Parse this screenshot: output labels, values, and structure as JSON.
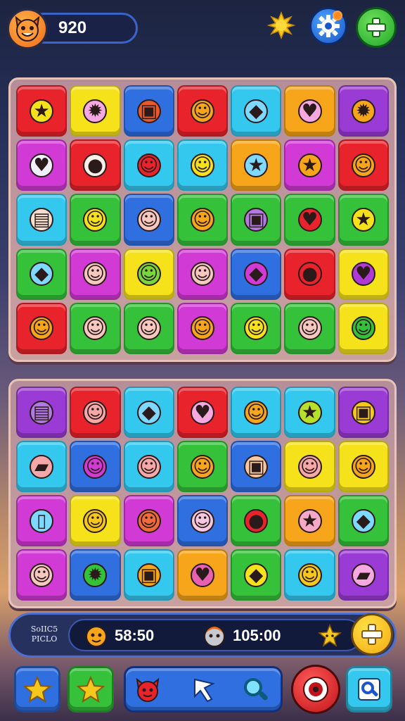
{
  "header": {
    "score": "920",
    "avatar_icon": "fox-face-icon",
    "icons": [
      "sun-icon",
      "gear-icon",
      "plus-icon"
    ]
  },
  "board_top": {
    "rows": [
      [
        {
          "c": "#e8232b",
          "g": "★",
          "gc": "#f5e21b"
        },
        {
          "c": "#f5e21b",
          "g": "✹",
          "gc": "#f6a8e0"
        },
        {
          "c": "#2f6fe0",
          "g": "▣",
          "gc": "#e85a2b"
        },
        {
          "c": "#e8232b",
          "g": "☺",
          "gc": "#f7a51a"
        },
        {
          "c": "#34c8ef",
          "g": "◆",
          "gc": "#7fd8ff"
        },
        {
          "c": "#f7a51a",
          "g": "♥",
          "gc": "#f6a8e0"
        },
        {
          "c": "#9b3bd6",
          "g": "✹",
          "gc": "#f7a51a"
        }
      ],
      [
        {
          "c": "#d23ad6",
          "g": "♥",
          "gc": "#f0f0ff"
        },
        {
          "c": "#e8232b",
          "g": "●",
          "gc": "#f8f0e8"
        },
        {
          "c": "#34c8ef",
          "g": "☺",
          "gc": "#e8232b"
        },
        {
          "c": "#34c8ef",
          "g": "☺",
          "gc": "#f5e21b"
        },
        {
          "c": "#f7a51a",
          "g": "★",
          "gc": "#7fd8ff"
        },
        {
          "c": "#d23ad6",
          "g": "★",
          "gc": "#f7a51a"
        },
        {
          "c": "#e8232b",
          "g": "☺",
          "gc": "#f7a51a"
        }
      ],
      [
        {
          "c": "#34c8ef",
          "g": "▤",
          "gc": "#f6e0d0"
        },
        {
          "c": "#35c23a",
          "g": "☺",
          "gc": "#f5e21b"
        },
        {
          "c": "#2f6fe0",
          "g": "☺",
          "gc": "#f6c8c0"
        },
        {
          "c": "#35c23a",
          "g": "☺",
          "gc": "#f7a51a"
        },
        {
          "c": "#35c23a",
          "g": "▣",
          "gc": "#b07ae0"
        },
        {
          "c": "#35c23a",
          "g": "♥",
          "gc": "#e8232b"
        },
        {
          "c": "#35c23a",
          "g": "★",
          "gc": "#f5e21b"
        }
      ],
      [
        {
          "c": "#35c23a",
          "g": "◆",
          "gc": "#7fd8ff"
        },
        {
          "c": "#d23ad6",
          "g": "☺",
          "gc": "#f6c8c0"
        },
        {
          "c": "#f5e21b",
          "g": "☺",
          "gc": "#7ad63a"
        },
        {
          "c": "#d23ad6",
          "g": "☺",
          "gc": "#f6c8c0"
        },
        {
          "c": "#2f6fe0",
          "g": "◆",
          "gc": "#d23ad6"
        },
        {
          "c": "#e8232b",
          "g": "●",
          "gc": "#e8232b"
        },
        {
          "c": "#f5e21b",
          "g": "♥",
          "gc": "#b03ad6"
        }
      ],
      [
        {
          "c": "#e8232b",
          "g": "☺",
          "gc": "#f7a51a"
        },
        {
          "c": "#35c23a",
          "g": "☺",
          "gc": "#f6c8c0"
        },
        {
          "c": "#35c23a",
          "g": "☺",
          "gc": "#f6c8c0"
        },
        {
          "c": "#d23ad6",
          "g": "☺",
          "gc": "#f7a51a"
        },
        {
          "c": "#35c23a",
          "g": "☺",
          "gc": "#f5e21b"
        },
        {
          "c": "#35c23a",
          "g": "☺",
          "gc": "#f6c8c0"
        },
        {
          "c": "#f5e21b",
          "g": "☺",
          "gc": "#35c23a"
        }
      ]
    ]
  },
  "board_bottom": {
    "rows": [
      [
        {
          "c": "#9b3bd6",
          "g": "▤",
          "gc": "#b07ae0"
        },
        {
          "c": "#e8232b",
          "g": "☺",
          "gc": "#f6a8a8"
        },
        {
          "c": "#34c8ef",
          "g": "◆",
          "gc": "#7fd8ff"
        },
        {
          "c": "#e8232b",
          "g": "♥",
          "gc": "#f6a8e0"
        },
        {
          "c": "#34c8ef",
          "g": "☺",
          "gc": "#f7a51a"
        },
        {
          "c": "#34c8ef",
          "g": "★",
          "gc": "#b6e02a"
        },
        {
          "c": "#9b3bd6",
          "g": "▣",
          "gc": "#f5c81b"
        }
      ],
      [
        {
          "c": "#34c8ef",
          "g": "▰",
          "gc": "#f6a8a8"
        },
        {
          "c": "#2f6fe0",
          "g": "☺",
          "gc": "#d23ad6"
        },
        {
          "c": "#34c8ef",
          "g": "☺",
          "gc": "#f6a8a8"
        },
        {
          "c": "#35c23a",
          "g": "☺",
          "gc": "#f7a51a"
        },
        {
          "c": "#2f6fe0",
          "g": "▣",
          "gc": "#f6c8a0"
        },
        {
          "c": "#f5e21b",
          "g": "☺",
          "gc": "#f6a8a8"
        },
        {
          "c": "#f5e21b",
          "g": "☺",
          "gc": "#f7a51a"
        }
      ],
      [
        {
          "c": "#d23ad6",
          "g": "▯",
          "gc": "#7fd8ff"
        },
        {
          "c": "#f5e21b",
          "g": "☺",
          "gc": "#f5c81b"
        },
        {
          "c": "#d23ad6",
          "g": "☺",
          "gc": "#f06a3a"
        },
        {
          "c": "#2f6fe0",
          "g": "☺",
          "gc": "#f6c8e0"
        },
        {
          "c": "#35c23a",
          "g": "●",
          "gc": "#e8232b"
        },
        {
          "c": "#f7a51a",
          "g": "★",
          "gc": "#f6a8c8"
        },
        {
          "c": "#35c23a",
          "g": "◆",
          "gc": "#7fd8ff"
        }
      ],
      [
        {
          "c": "#d23ad6",
          "g": "☺",
          "gc": "#f6c8c0"
        },
        {
          "c": "#2f6fe0",
          "g": "✹",
          "gc": "#35c23a"
        },
        {
          "c": "#34c8ef",
          "g": "▣",
          "gc": "#f7a51a"
        },
        {
          "c": "#f7a51a",
          "g": "♥",
          "gc": "#e860b0"
        },
        {
          "c": "#35c23a",
          "g": "◆",
          "gc": "#f5e21b"
        },
        {
          "c": "#34c8ef",
          "g": "☺",
          "gc": "#f5c81b"
        },
        {
          "c": "#9b3bd6",
          "g": "▰",
          "gc": "#f6a8e0"
        }
      ]
    ]
  },
  "status": {
    "label": "SoIIC5 PICLO",
    "stat1": "58:50",
    "stat2": "105:00"
  },
  "bottom_bar": {
    "icons": [
      "star-icon",
      "star-icon",
      "fox-face-icon",
      "cursor-icon",
      "magnifier-icon",
      "record-icon",
      "search-icon"
    ]
  }
}
